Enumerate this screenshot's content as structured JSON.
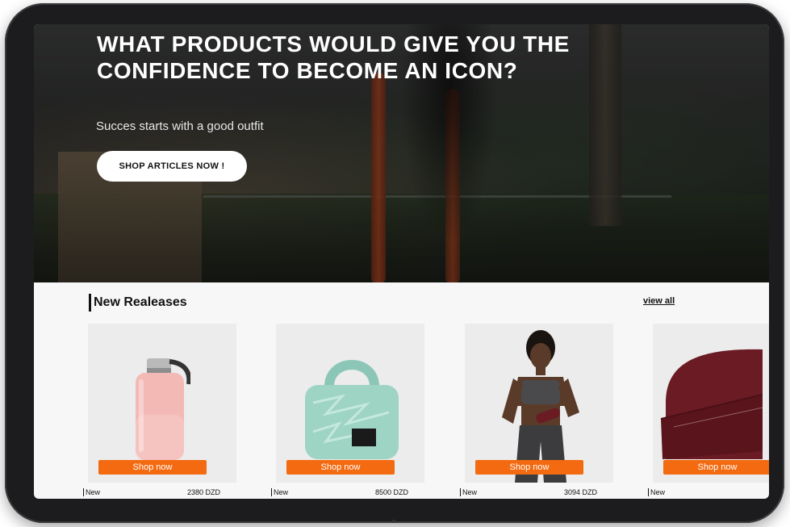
{
  "hero": {
    "title": "WHAT PRODUCTS WOULD GIVE YOU THE CONFIDENCE TO BECOME AN ICON?",
    "subtitle": "Succes starts with a good outfit",
    "cta_label": "SHOP ARTICLES NOW !"
  },
  "releases": {
    "title": "New Realeases",
    "view_all_label": "view all",
    "products": [
      {
        "icon": "water-bottle-image",
        "button_label": "Shop now",
        "tag": "New",
        "price": "2380 DZD"
      },
      {
        "icon": "puffer-bag-image",
        "button_label": "Shop now",
        "tag": "New",
        "price": "8500 DZD"
      },
      {
        "icon": "woman-model-image",
        "button_label": "Shop now",
        "tag": "New",
        "price": "3094 DZD"
      },
      {
        "icon": "beanie-image",
        "button_label": "Shop now",
        "tag": "New",
        "price": ""
      }
    ]
  },
  "colors": {
    "accent": "#f36a10",
    "hero_text": "#ffffff",
    "bag": "#9ed4c4",
    "bottle": "#f3b9b5",
    "beanie": "#6a1b24"
  }
}
